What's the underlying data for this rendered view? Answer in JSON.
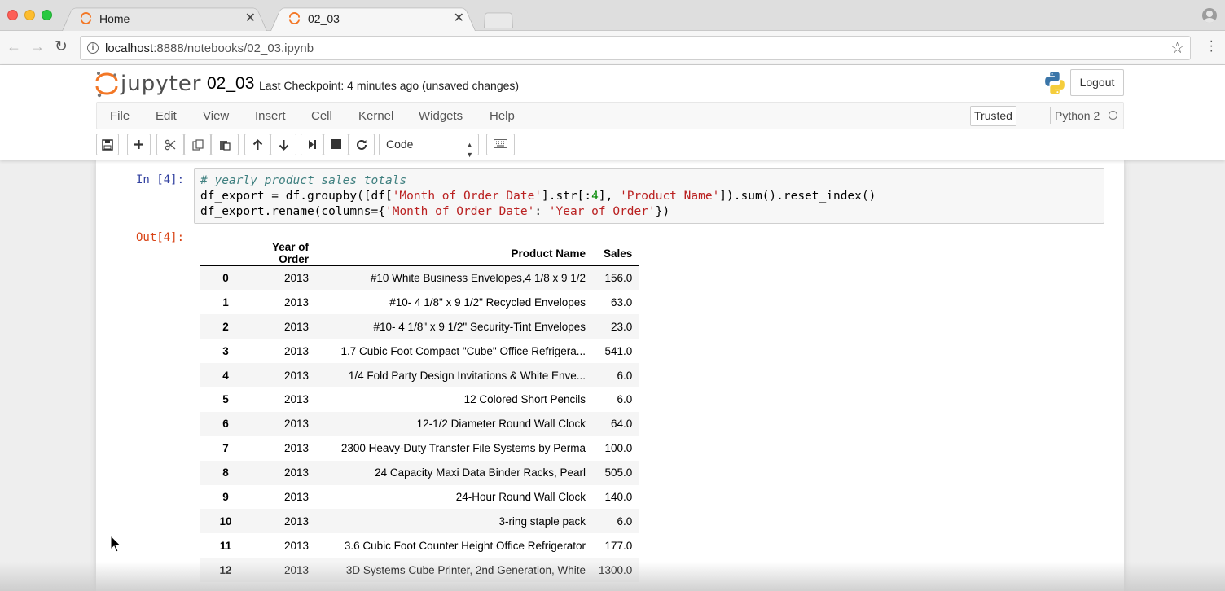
{
  "browser": {
    "tabs": [
      {
        "title": "Home"
      },
      {
        "title": "02_03"
      }
    ],
    "url_host": "localhost",
    "url_rest": ":8888/notebooks/02_03.ipynb"
  },
  "jupyter": {
    "logo_text": "jupyter",
    "notebook_name": "02_03",
    "checkpoint": "Last Checkpoint: 4 minutes ago (unsaved changes)",
    "logout_label": "Logout",
    "menu": [
      "File",
      "Edit",
      "View",
      "Insert",
      "Cell",
      "Kernel",
      "Widgets",
      "Help"
    ],
    "trusted_label": "Trusted",
    "kernel_name": "Python 2",
    "cell_type": "Code"
  },
  "cell": {
    "in_prompt": "In [4]:",
    "out_prompt": "Out[4]:",
    "code_comment": "# yearly product sales totals",
    "code_line2_a": "df_export = df.groupby([df[",
    "code_line2_str1": "'Month of Order Date'",
    "code_line2_b": "].str[:",
    "code_line2_num": "4",
    "code_line2_c": "], ",
    "code_line2_str2": "'Product Name'",
    "code_line2_d": "]).sum().reset_index()",
    "code_line3_a": "df_export.rename(columns={",
    "code_line3_str1": "'Month of Order Date'",
    "code_line3_b": ": ",
    "code_line3_str2": "'Year of Order'",
    "code_line3_c": "})"
  },
  "table": {
    "headers": [
      "",
      "Year of Order",
      "Product Name",
      "Sales"
    ],
    "rows": [
      [
        "0",
        "2013",
        "#10 White Business Envelopes,4 1/8 x 9 1/2",
        "156.0"
      ],
      [
        "1",
        "2013",
        "#10- 4 1/8\" x 9 1/2\" Recycled Envelopes",
        "63.0"
      ],
      [
        "2",
        "2013",
        "#10- 4 1/8\" x 9 1/2\" Security-Tint Envelopes",
        "23.0"
      ],
      [
        "3",
        "2013",
        "1.7 Cubic Foot Compact \"Cube\" Office Refrigera...",
        "541.0"
      ],
      [
        "4",
        "2013",
        "1/4 Fold Party Design Invitations & White Enve...",
        "6.0"
      ],
      [
        "5",
        "2013",
        "12 Colored Short Pencils",
        "6.0"
      ],
      [
        "6",
        "2013",
        "12-1/2 Diameter Round Wall Clock",
        "64.0"
      ],
      [
        "7",
        "2013",
        "2300 Heavy-Duty Transfer File Systems by Perma",
        "100.0"
      ],
      [
        "8",
        "2013",
        "24 Capacity Maxi Data Binder Racks, Pearl",
        "505.0"
      ],
      [
        "9",
        "2013",
        "24-Hour Round Wall Clock",
        "140.0"
      ],
      [
        "10",
        "2013",
        "3-ring staple pack",
        "6.0"
      ],
      [
        "11",
        "2013",
        "3.6 Cubic Foot Counter Height Office Refrigerator",
        "177.0"
      ],
      [
        "12",
        "2013",
        "3D Systems Cube Printer, 2nd Generation, White",
        "1300.0"
      ]
    ]
  },
  "colors": {
    "jupyter_orange": "#f37726",
    "in_prompt": "#303f9f",
    "out_prompt": "#d84315"
  }
}
